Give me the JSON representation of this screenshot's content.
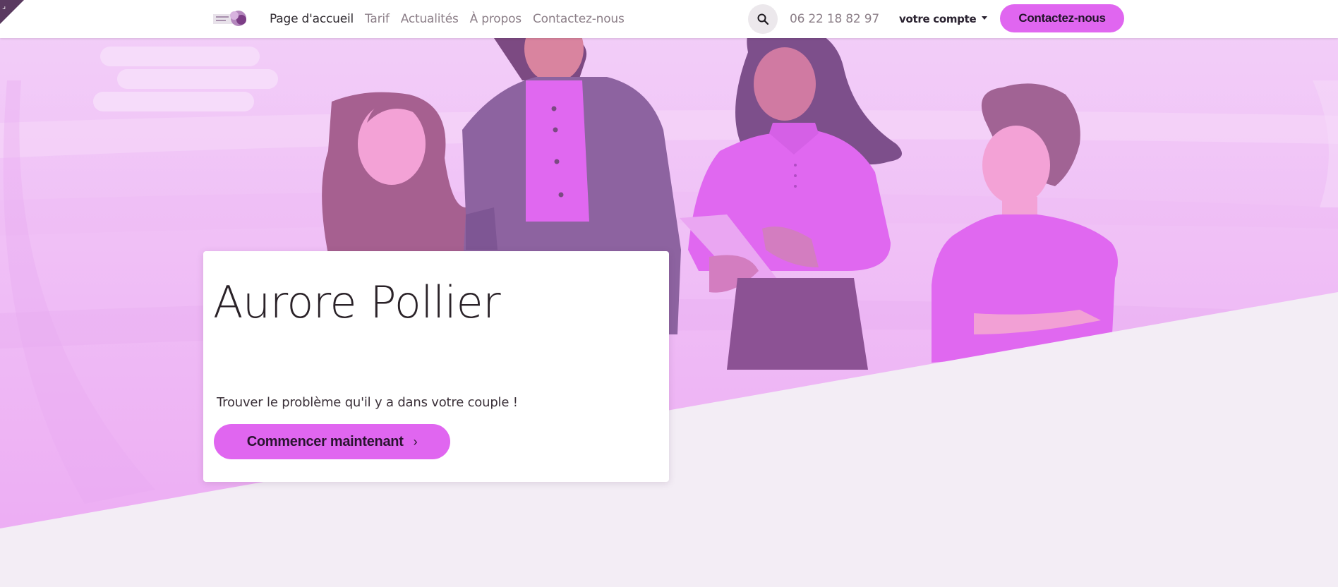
{
  "header": {
    "corner_glyph": "⌟",
    "logo_icon": "logo-icon",
    "nav": [
      {
        "label": "Page d'accueil",
        "active": true
      },
      {
        "label": "Tarif",
        "active": false
      },
      {
        "label": "Actualités",
        "active": false
      },
      {
        "label": "À propos",
        "active": false
      },
      {
        "label": "Contactez-nous",
        "active": false
      }
    ],
    "search_icon": "search-icon",
    "phone": "06 22 18 82 97",
    "account_label": "votre compte",
    "contact_button": "Contactez-nous"
  },
  "hero": {
    "title": "Aurore Pollier",
    "tagline": "Trouver le problème qu'il y a dans votre couple !",
    "cta_label": "Commencer maintenant",
    "cta_icon": "chevron-right-icon"
  },
  "colors": {
    "accent": "#e066f0",
    "hero_bg": "#f0c8f5",
    "lower_bg": "#f3edf5",
    "figure_dark": "#8a5090"
  }
}
